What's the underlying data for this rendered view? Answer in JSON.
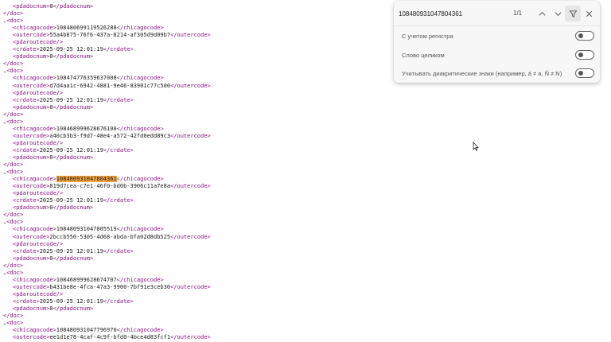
{
  "xml": {
    "first_lines": [
      {
        "indent": 1,
        "toggle": "",
        "open": "<pdadocnum>",
        "value": "0",
        "close": "</pdadocnum>"
      },
      {
        "indent": 0,
        "toggle": "",
        "open": "</doc>",
        "value": "",
        "close": ""
      }
    ],
    "docs": [
      {
        "chicagocode": "108480699119526288",
        "outercode": "55a4b875-76f6-437a-8214-af305d9d09b7",
        "crdate": "2025-09-25 12:01:19",
        "pdadocnum": "0",
        "highlight": false
      },
      {
        "chicagocode": "108474776359637008",
        "outercode": "d7d4aa1c-6942-4881-9e46-83901c77c500",
        "crdate": "2025-09-25 12:01:19",
        "pdadocnum": "0",
        "highlight": false
      },
      {
        "chicagocode": "108468999628676100",
        "outercode": "a40cb3b3-f9d7-48e4-a572-42fd0edd89c3",
        "crdate": "2025-09-25 12:01:19",
        "pdadocnum": "0",
        "highlight": false
      },
      {
        "chicagocode": "108480931047804361",
        "outercode": "819d7cea-c7e1-46f0-bd0b-3906c11a7e8a",
        "crdate": "2025-09-25 12:01:19",
        "pdadocnum": "0",
        "highlight": true
      },
      {
        "chicagocode": "108480931047805519",
        "outercode": "2bccb550-5305-4d68-abda-bfa02d8db525",
        "crdate": "2025-09-25 12:01:19",
        "pdadocnum": "0",
        "highlight": false
      },
      {
        "chicagocode": "108468999628674707",
        "outercode": "b431be8e-4fca-47a3-9900-7bf91e3ceb30",
        "crdate": "2025-09-25 12:01:19",
        "pdadocnum": "0",
        "highlight": false
      },
      {
        "chicagocode": "108480931047796970",
        "outercode": "ee1d1e78-4caf-4c9f-bfd0-4bce4d83fcf1",
        "crdate": "",
        "pdadocnum": "",
        "highlight": false,
        "partial": true
      }
    ],
    "toggle_glyph": "⌄"
  },
  "find": {
    "query": "108480931047804361",
    "match_count": "1/1",
    "options": [
      {
        "label": "С учетом регистра",
        "on": false
      },
      {
        "label": "Слово целиком",
        "on": false
      },
      {
        "label": "Учитывать диакритические знаки (например, á ≠ a, Ñ ≠ N)",
        "on": false
      }
    ]
  }
}
